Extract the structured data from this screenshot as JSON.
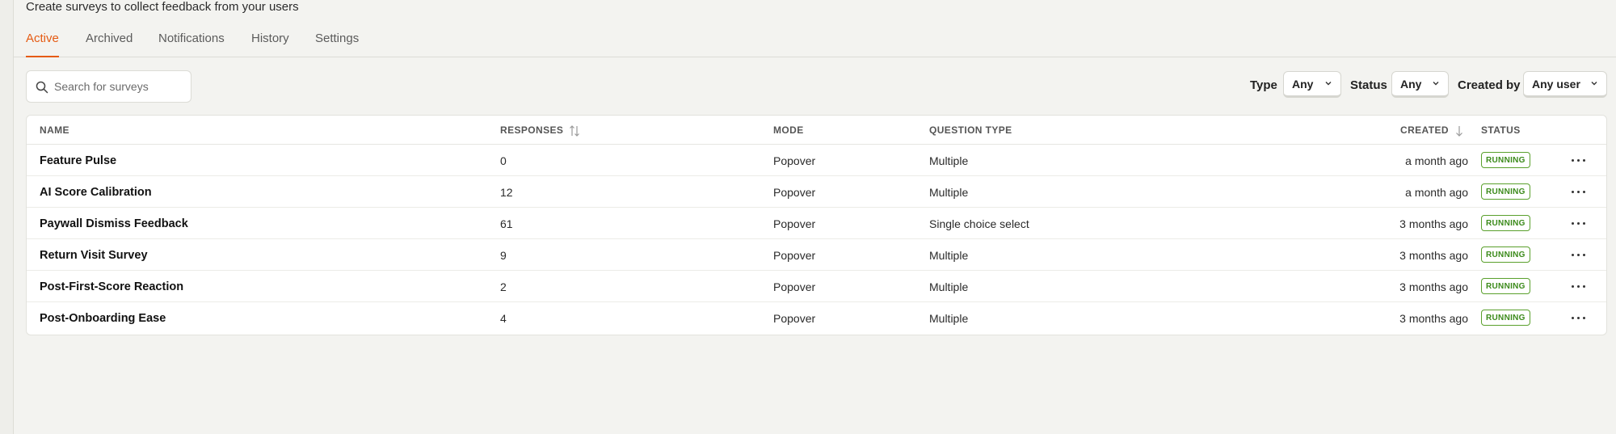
{
  "page": {
    "subtitle": "Create surveys to collect feedback from your users"
  },
  "tabs": [
    {
      "label": "Active",
      "active": true
    },
    {
      "label": "Archived"
    },
    {
      "label": "Notifications"
    },
    {
      "label": "History"
    },
    {
      "label": "Settings"
    }
  ],
  "search": {
    "placeholder": "Search for surveys",
    "icon": "search-icon"
  },
  "filters": {
    "type": {
      "label": "Type",
      "value": "Any"
    },
    "status": {
      "label": "Status",
      "value": "Any"
    },
    "created_by": {
      "label": "Created by",
      "value": "Any user"
    }
  },
  "table": {
    "columns": {
      "name": "NAME",
      "responses": "RESPONSES",
      "mode": "MODE",
      "question_type": "QUESTION TYPE",
      "created": "CREATED",
      "status": "STATUS"
    },
    "rows": [
      {
        "name": "Feature Pulse",
        "responses": "0",
        "mode": "Popover",
        "question_type": "Multiple",
        "created": "a month ago",
        "status": "RUNNING"
      },
      {
        "name": "AI Score Calibration",
        "responses": "12",
        "mode": "Popover",
        "question_type": "Multiple",
        "created": "a month ago",
        "status": "RUNNING"
      },
      {
        "name": "Paywall Dismiss Feedback",
        "responses": "61",
        "mode": "Popover",
        "question_type": "Single choice select",
        "created": "3 months ago",
        "status": "RUNNING"
      },
      {
        "name": "Return Visit Survey",
        "responses": "9",
        "mode": "Popover",
        "question_type": "Multiple",
        "created": "3 months ago",
        "status": "RUNNING"
      },
      {
        "name": "Post-First-Score Reaction",
        "responses": "2",
        "mode": "Popover",
        "question_type": "Multiple",
        "created": "3 months ago",
        "status": "RUNNING"
      },
      {
        "name": "Post-Onboarding Ease",
        "responses": "4",
        "mode": "Popover",
        "question_type": "Multiple",
        "created": "3 months ago",
        "status": "RUNNING"
      }
    ]
  },
  "colors": {
    "accent": "#e55b13",
    "running": "#3b8a1a",
    "background": "#f3f3f0"
  }
}
